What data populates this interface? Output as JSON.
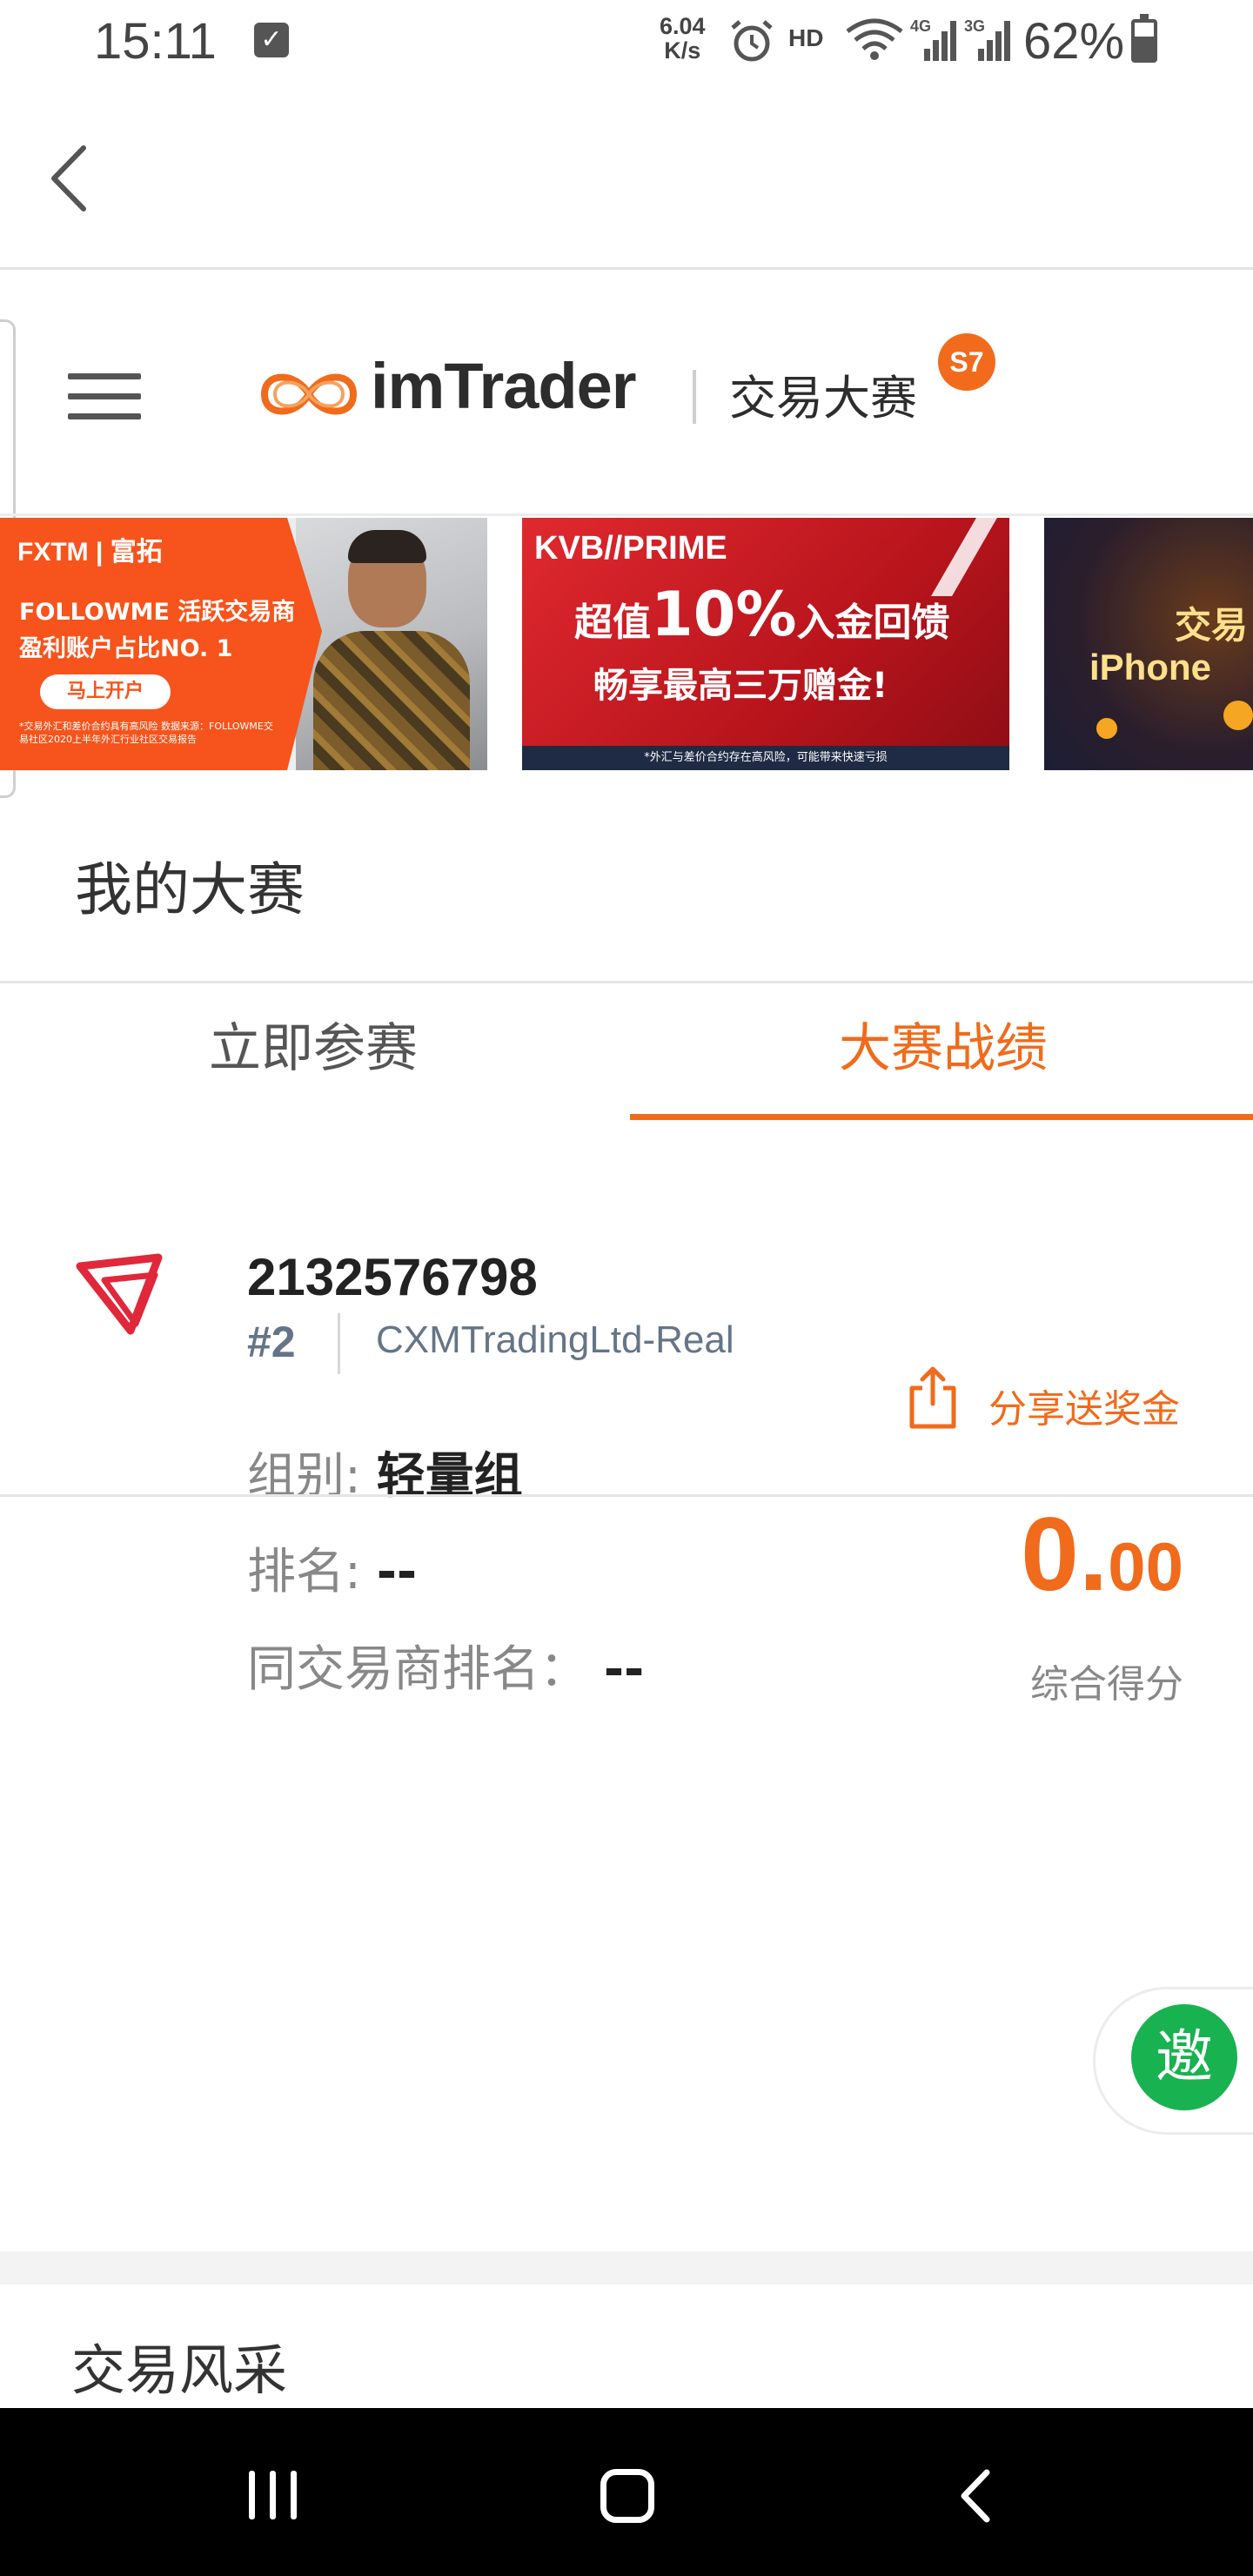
{
  "status_bar": {
    "time": "15:11",
    "net_speed_value": "6.04",
    "net_speed_unit": "K/s",
    "hd": "HD",
    "battery": "62%",
    "icons": [
      "check-icon",
      "alarm-icon",
      "wifi-icon",
      "signal-4g-icon",
      "signal-3g-icon",
      "battery-icon"
    ]
  },
  "app_bar": {
    "back_icon": "chevron-left-icon"
  },
  "header": {
    "logo_text": "imTrader",
    "logo_sub": "交易大赛",
    "season_badge": "S7"
  },
  "banners": [
    {
      "brand": "FXTM | 富拓",
      "line1": "FOLLOWME 活跃交易商",
      "line2": "盈利账户占比NO. 1",
      "button": "马上开户",
      "note": "*交易外汇和差价合约具有高风险 数据来源：FOLLOWME交易社区2020上半年外汇行业社区交易报告"
    },
    {
      "brand": "KVB//PRIME",
      "line1_a": "超值",
      "line1_b": "10%",
      "line1_c": "入金回馈",
      "line2": "畅享最高三万赠金!",
      "note": "*外汇与差价合约存在高风险，可能带来快速亏损"
    },
    {
      "line1": "交易",
      "line2": "iPhone"
    }
  ],
  "my_contest": {
    "title": "我的大赛",
    "tabs": [
      {
        "label": "立即参赛",
        "active": false
      },
      {
        "label": "大赛战绩",
        "active": true
      }
    ]
  },
  "account": {
    "id": "2132576798",
    "number": "#2",
    "broker": "CXMTradingLtd-Real",
    "share_label": "分享送奖金",
    "group_label": "组别:",
    "group_value": "轻量组",
    "rank_label": "排名:",
    "rank_value": "--",
    "broker_rank_label": "同交易商排名：",
    "broker_rank_value": "--",
    "score_int": "0.",
    "score_dec": "00",
    "score_label": "综合得分"
  },
  "invite": {
    "label": "邀"
  },
  "section2": {
    "title": "交易风采"
  },
  "colors": {
    "accent": "#f06b1b",
    "invite_green": "#19b250",
    "muted_text": "#657587"
  }
}
